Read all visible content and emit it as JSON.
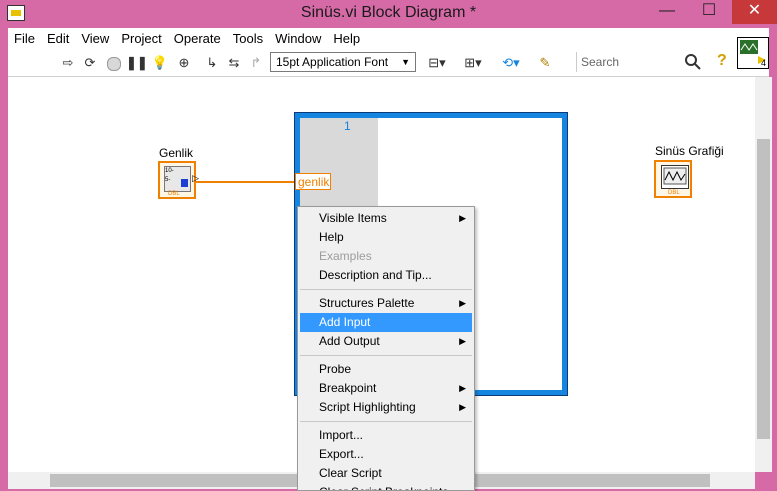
{
  "window": {
    "title": "Sinüs.vi Block Diagram *",
    "minimize": "—",
    "maximize": "☐",
    "close": "✕"
  },
  "menu": [
    "File",
    "Edit",
    "View",
    "Project",
    "Operate",
    "Tools",
    "Window",
    "Help"
  ],
  "toolbar": {
    "font": "15pt Application Font",
    "search_placeholder": "Search",
    "help": "?",
    "icons": [
      "run-arrow",
      "run-continuously",
      "abort",
      "pause",
      "highlight-execution",
      "retain-wire-values",
      "step-into",
      "step-over",
      "step-out",
      "align",
      "distribute",
      "reorder",
      "clean-up"
    ]
  },
  "vi_icon_number": "4",
  "diagram": {
    "genlik_label": "Genlik",
    "genlik_type": "DBL",
    "genlik_values": [
      "10-",
      "5-"
    ],
    "graph_label": "Sinüs Grafiği",
    "graph_type": "DBL",
    "tunnel_label": "genlik",
    "loop_count": "1"
  },
  "context_menu": [
    {
      "label": "Visible Items",
      "sub": true,
      "enabled": true
    },
    {
      "label": "Help",
      "sub": false,
      "enabled": true
    },
    {
      "label": "Examples",
      "sub": false,
      "enabled": false
    },
    {
      "label": "Description and Tip...",
      "sub": false,
      "enabled": true
    },
    {
      "sep": true
    },
    {
      "label": "Structures Palette",
      "sub": true,
      "enabled": true
    },
    {
      "label": "Add Input",
      "sub": false,
      "enabled": true,
      "highlighted": true
    },
    {
      "label": "Add Output",
      "sub": true,
      "enabled": true
    },
    {
      "sep": true
    },
    {
      "label": "Probe",
      "sub": false,
      "enabled": true
    },
    {
      "label": "Breakpoint",
      "sub": true,
      "enabled": true
    },
    {
      "label": "Script Highlighting",
      "sub": true,
      "enabled": true
    },
    {
      "sep": true
    },
    {
      "label": "Import...",
      "sub": false,
      "enabled": true
    },
    {
      "label": "Export...",
      "sub": false,
      "enabled": true
    },
    {
      "label": "Clear Script",
      "sub": false,
      "enabled": true
    },
    {
      "label": "Clear Script Breakpoints",
      "sub": false,
      "enabled": true
    }
  ],
  "colors": {
    "accent": "#1585e0",
    "wire": "#f08000",
    "highlight": "#3399ff",
    "titlebar": "#d66aa6"
  }
}
